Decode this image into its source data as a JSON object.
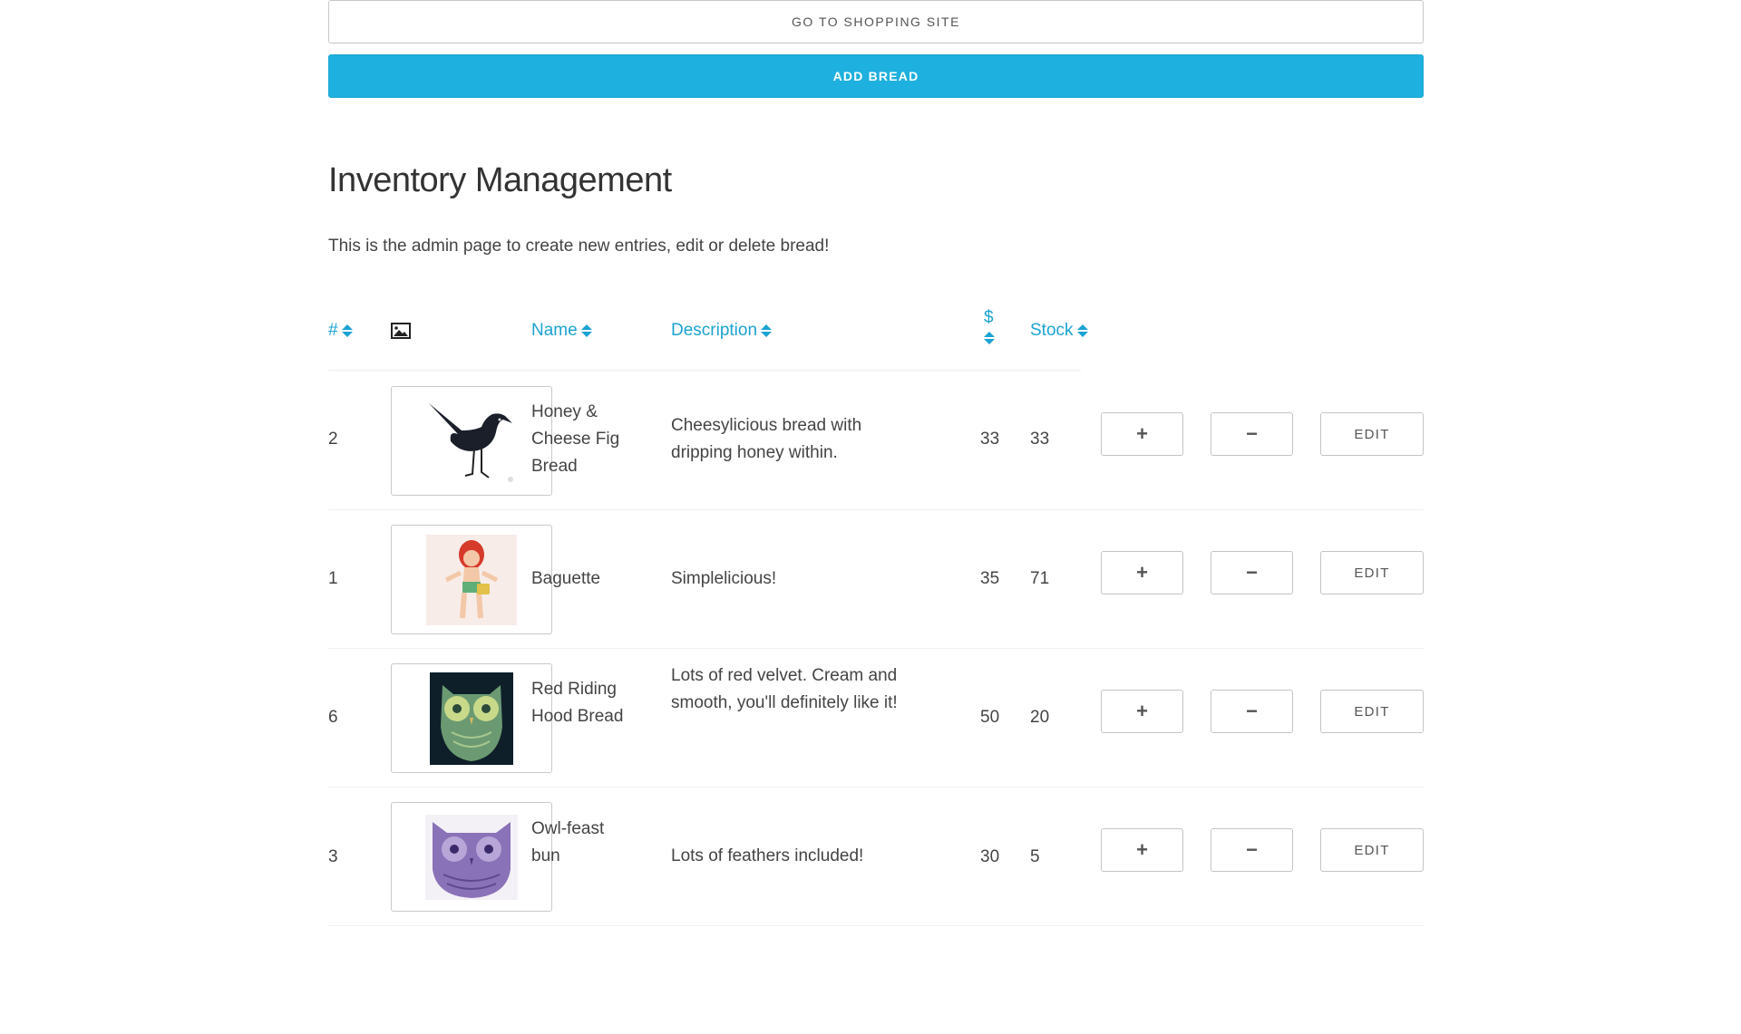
{
  "nav": {
    "shopping_label": "GO TO SHOPPING SITE",
    "add_label": "ADD BREAD"
  },
  "page": {
    "title": "Inventory Management",
    "subtitle": "This is the admin page to create new entries, edit or delete bread!"
  },
  "table": {
    "headers": {
      "id": "#",
      "image_icon": "image-icon",
      "name": "Name",
      "description": "Description",
      "price": "$",
      "stock": "Stock"
    },
    "rows": [
      {
        "id": "2",
        "image": "blackbird",
        "name": "Honey & Cheese Fig Bread",
        "description": "Cheesylicious bread with dripping honey within.",
        "price": "33",
        "stock": "33"
      },
      {
        "id": "1",
        "image": "red-haired-girl",
        "name": "Baguette",
        "description": "Simplelicious!",
        "price": "35",
        "stock": "71"
      },
      {
        "id": "6",
        "image": "green-owl",
        "name": "Red Riding Hood Bread",
        "description": "Lots of red velvet. Cream and smooth, you'll definitely like it!",
        "price": "50",
        "stock": "20"
      },
      {
        "id": "3",
        "image": "purple-owl",
        "name": "Owl-feast bun",
        "description": "Lots of feathers included!",
        "price": "30",
        "stock": "5"
      }
    ],
    "actions": {
      "plus": "+",
      "minus": "−",
      "edit": "EDIT"
    }
  },
  "colors": {
    "accent": "#1eb0de",
    "link": "#1ba3d2",
    "text": "#444444"
  }
}
